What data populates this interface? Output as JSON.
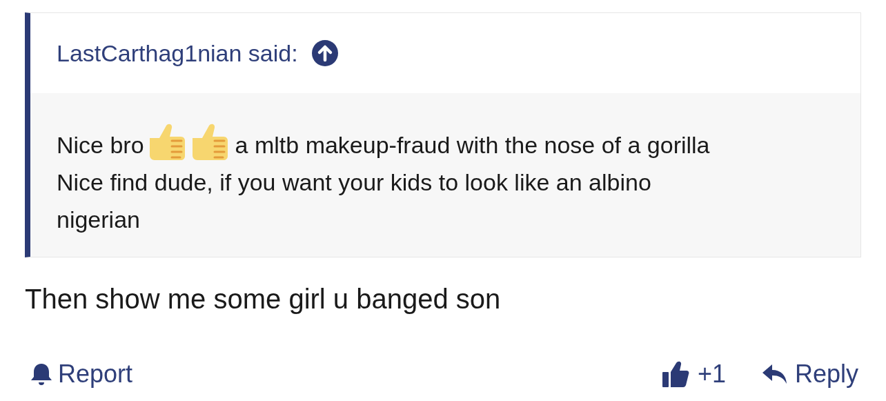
{
  "quote": {
    "attribution": "LastCarthag1nian said:",
    "line_1_start": "Nice bro",
    "line_1_end": "a mltb makeup-fraud with the nose of a gorilla",
    "line_2": "Nice find dude, if you want your kids to look like an albino nigerian"
  },
  "message": "Then show me some girl u banged son",
  "actions": {
    "report": "Report",
    "likes": "+1",
    "reply": "Reply"
  }
}
